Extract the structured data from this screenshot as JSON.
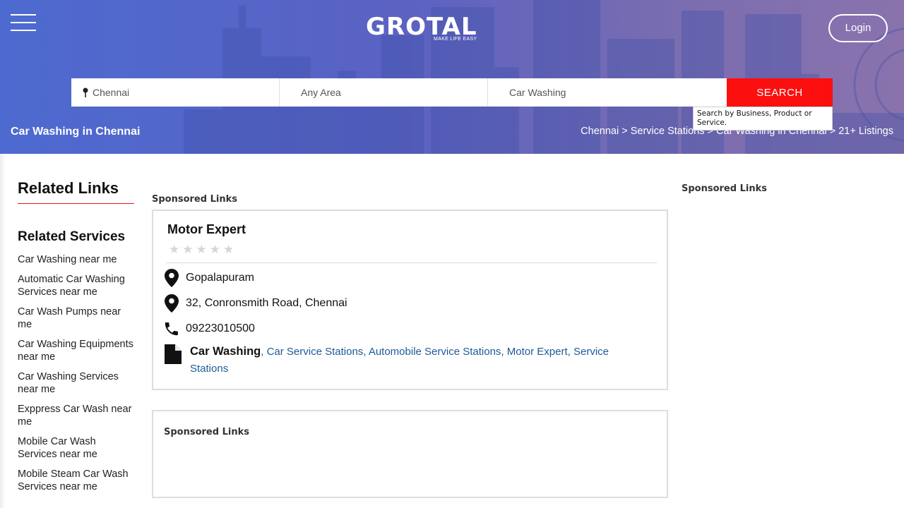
{
  "header": {
    "logo_text": "GROTAL",
    "logo_tagline": "MAKE LIFE EASY",
    "login_label": "Login"
  },
  "search": {
    "city": "Chennai",
    "area_placeholder": "Any Area",
    "query": "Car Washing",
    "button_label": "SEARCH",
    "tooltip": "Search by Business, Product or Service."
  },
  "page": {
    "heading": "Car Washing in Chennai",
    "breadcrumb": [
      "Chennai",
      "Service Stations",
      "Car Washing in Chennai",
      "21+ Listings"
    ]
  },
  "sidebar": {
    "related_links_title": "Related Links",
    "related_services_title": "Related Services",
    "items": [
      "Car Washing near me",
      "Automatic Car Washing Services near me",
      "Car Wash Pumps near me",
      "Car Washing Equipments near me",
      "Car Washing Services near me",
      "Exppress Car Wash near me",
      "Mobile Car Wash Services near me",
      "Mobile Steam Car Wash Services near me"
    ]
  },
  "sponsored_label": "Sponsored Links",
  "listing": {
    "name": "Motor Expert",
    "rating_stars": 0,
    "locality": "Gopalapuram",
    "address": "32, Conronsmith Road, Chennai",
    "phone": "09223010500",
    "main_category": "Car Washing",
    "categories": [
      "Car Service Stations",
      "Automobile Service Stations",
      "Motor Expert",
      "Service Stations"
    ]
  },
  "icons": {
    "menu": "hamburger-icon",
    "location": "map-pin-icon",
    "phone": "phone-icon",
    "category": "document-icon",
    "star": "star-icon"
  },
  "colors": {
    "accent": "#fc0f0f",
    "link": "#1d5a9a",
    "hero_start": "#4d6ad0",
    "hero_end": "#8a73ad"
  }
}
